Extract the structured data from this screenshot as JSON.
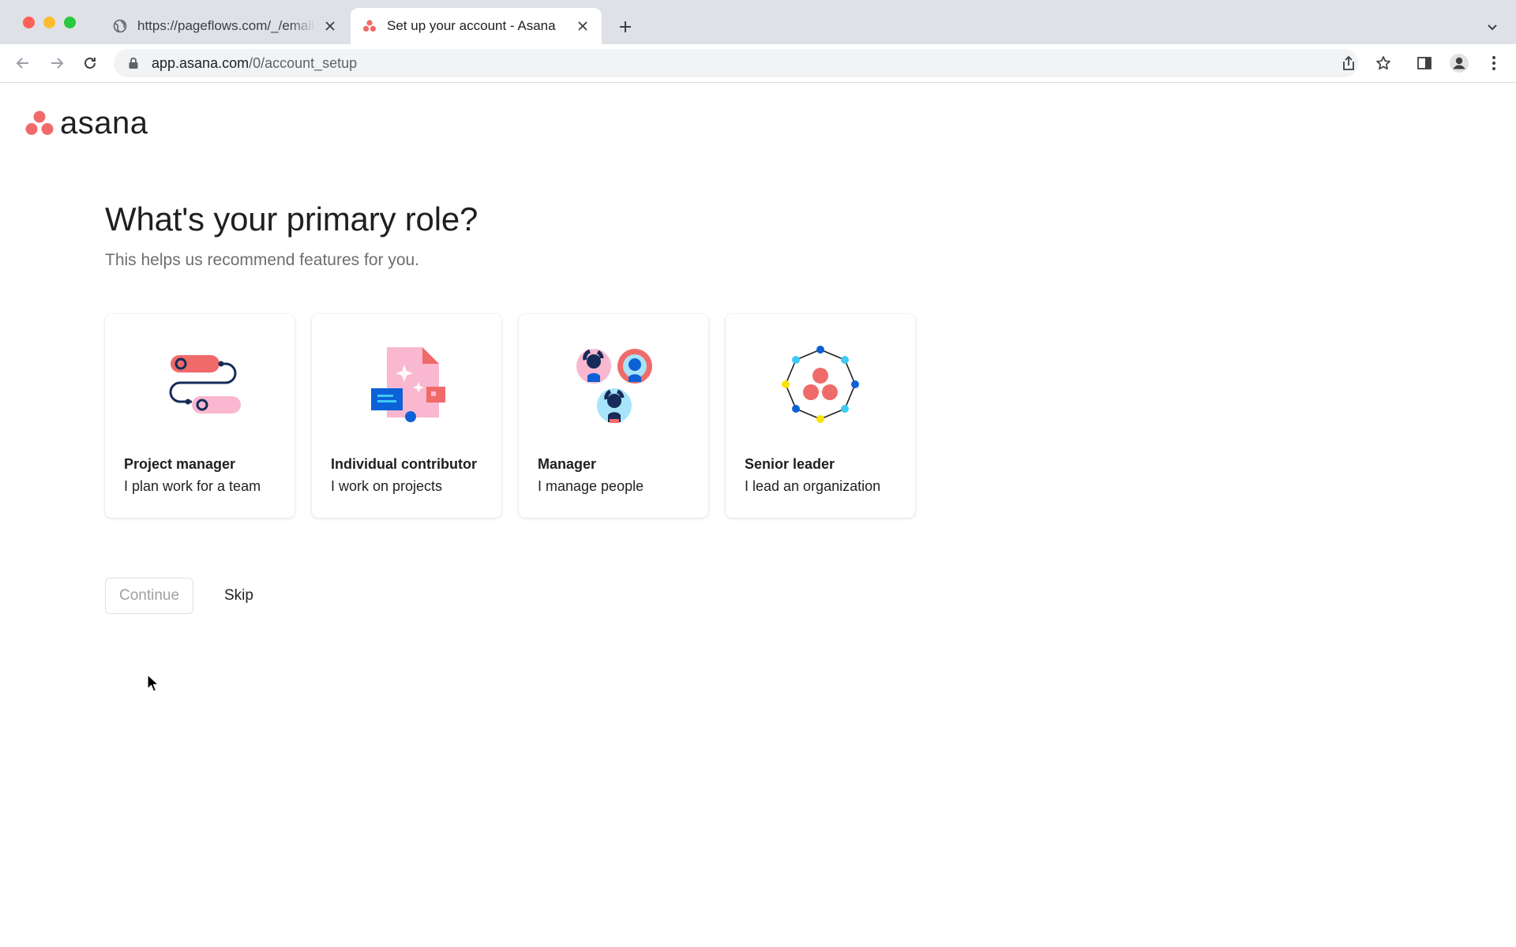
{
  "browser": {
    "tabs": [
      {
        "title": "https://pageflows.com/_/emails",
        "favicon": "globe-icon",
        "active": false
      },
      {
        "title": "Set up your account - Asana",
        "favicon": "asana-icon",
        "active": true
      }
    ],
    "address": {
      "host": "app.asana.com",
      "path": "/0/account_setup"
    }
  },
  "brand": {
    "name": "asana",
    "color": "#f06a6a"
  },
  "page": {
    "heading": "What's your primary role?",
    "subheading": "This helps us recommend features for you."
  },
  "roles": [
    {
      "title": "Project manager",
      "description": "I plan work for a team",
      "icon": "project-manager-illustration"
    },
    {
      "title": "Individual contributor",
      "description": "I work on projects",
      "icon": "individual-contributor-illustration"
    },
    {
      "title": "Manager",
      "description": "I manage people",
      "icon": "manager-illustration"
    },
    {
      "title": "Senior leader",
      "description": "I lead an organization",
      "icon": "senior-leader-illustration"
    }
  ],
  "actions": {
    "continue_label": "Continue",
    "skip_label": "Skip",
    "continue_enabled": false
  },
  "colors": {
    "pink": "#f06a6a",
    "light_pink": "#f9b8cf",
    "navy": "#162b59",
    "blue": "#0d61d6",
    "cyan": "#3fcaf5",
    "yellow": "#f9e300"
  }
}
